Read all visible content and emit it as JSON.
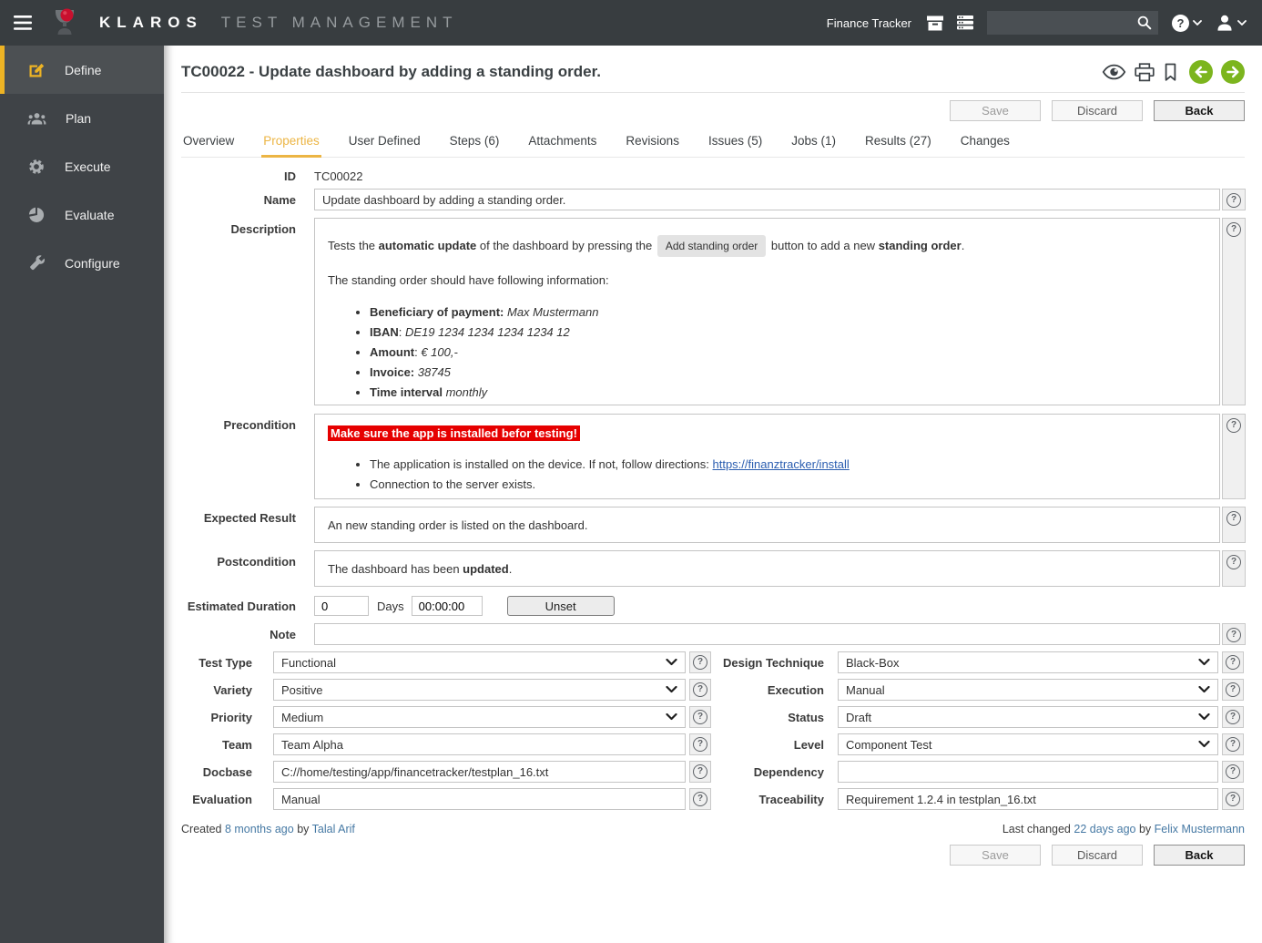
{
  "icons": {
    "help_glyph": "?"
  },
  "topbar": {
    "brand_primary": "KLAROS",
    "brand_secondary": "TEST MANAGEMENT",
    "project_label": "Finance Tracker",
    "search_value": ""
  },
  "sidebar": {
    "items": [
      {
        "label": "Define"
      },
      {
        "label": "Plan"
      },
      {
        "label": "Execute"
      },
      {
        "label": "Evaluate"
      },
      {
        "label": "Configure"
      }
    ]
  },
  "page": {
    "title": "TC00022 - Update dashboard by adding a standing order.",
    "buttons": {
      "save": "Save",
      "discard": "Discard",
      "back": "Back"
    },
    "tabs": [
      "Overview",
      "Properties",
      "User Defined",
      "Steps (6)",
      "Attachments",
      "Revisions",
      "Issues (5)",
      "Jobs (1)",
      "Results (27)",
      "Changes"
    ]
  },
  "form": {
    "id": {
      "label": "ID",
      "value": "TC00022"
    },
    "name": {
      "label": "Name",
      "value": "Update dashboard by adding a standing order."
    },
    "description": {
      "label": "Description",
      "p1": {
        "a": "Tests the ",
        "b": "automatic update",
        "c": " of the dashboard by pressing the ",
        "chip": "Add standing order",
        "d": " button to add a new ",
        "e": "standing order",
        "f": "."
      },
      "p2": "The standing order should have following information:",
      "bullets": [
        {
          "b": "Beneficiary of payment:",
          "sep": " ",
          "i": "Max Mustermann"
        },
        {
          "b": "IBAN",
          "sep": ": ",
          "i": "DE19 1234 1234 1234 1234 12"
        },
        {
          "b": "Amount",
          "sep": ": ",
          "i": "€ 100,-"
        },
        {
          "b": "Invoice:",
          "sep": " ",
          "i": "38745"
        },
        {
          "b": "Time interval",
          "sep": " ",
          "i": "monthly"
        }
      ]
    },
    "precondition": {
      "label": "Precondition",
      "warning": "Make sure the app is installed befor testing!",
      "bullet1_text": "The application is installed on the device. If not, follow directions: ",
      "bullet1_link": "https://finanztracker/install",
      "bullet2": "Connection to the server exists."
    },
    "expected_result": {
      "label": "Expected Result",
      "value": "An new standing order is listed on the dashboard."
    },
    "postcondition": {
      "label": "Postcondition",
      "prefix": "The dashboard has been ",
      "bold": "updated",
      "suffix": "."
    },
    "estimated_duration": {
      "label": "Estimated Duration",
      "days_value": "0",
      "days_label": "Days",
      "time_value": "00:00:00",
      "unset_label": "Unset"
    },
    "note": {
      "label": "Note",
      "value": ""
    },
    "left_fields": [
      {
        "label": "Test Type",
        "value": "Functional"
      },
      {
        "label": "Variety",
        "value": "Positive"
      },
      {
        "label": "Priority",
        "value": "Medium"
      },
      {
        "label": "Team",
        "value": "Team Alpha"
      },
      {
        "label": "Docbase",
        "value": "C://home/testing/app/financetracker/testplan_16.txt"
      },
      {
        "label": "Evaluation",
        "value": "Manual"
      }
    ],
    "right_fields": [
      {
        "label": "Design Technique",
        "value": "Black-Box"
      },
      {
        "label": "Execution",
        "value": "Manual"
      },
      {
        "label": "Status",
        "value": "Draft"
      },
      {
        "label": "Level",
        "value": "Component Test"
      },
      {
        "label": "Dependency",
        "value": ""
      },
      {
        "label": "Traceability",
        "value": "Requirement 1.2.4 in testplan_16.txt"
      }
    ]
  },
  "footer": {
    "created_prefix": "Created",
    "created_time": "8 months ago",
    "created_by": "by",
    "created_user": "Talal Arif",
    "changed_prefix": "Last changed",
    "changed_time": "22 days ago",
    "changed_by": "by",
    "changed_user": "Felix Mustermann"
  },
  "colors": {
    "accent": "#edb324",
    "tab_active": "#ecb544",
    "green": "#7cb51e",
    "warning_red": "#e60000",
    "link": "#2a5db0",
    "topbar": "#383d40",
    "sidebar": "#3f4347"
  }
}
